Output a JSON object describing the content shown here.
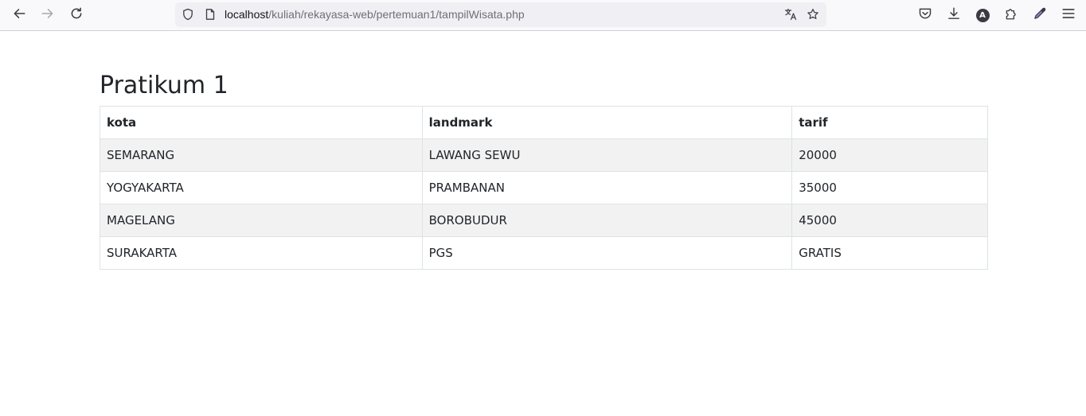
{
  "browser": {
    "url_host": "localhost",
    "url_path": "/kuliah/rekayasa-web/pertemuan1/tampilWisata.php",
    "icons": {
      "back": "back-arrow-icon",
      "forward": "forward-arrow-icon",
      "reload": "reload-icon",
      "tracking": "shield-icon",
      "page_info": "page-icon",
      "translate": "translate-icon",
      "bookmark": "star-icon",
      "pocket": "pocket-icon",
      "downloads": "download-icon",
      "account": "account-icon",
      "extensions": "extensions-icon",
      "eyedropper": "eyedropper-icon",
      "menu": "hamburger-menu-icon"
    },
    "account_initial": "A"
  },
  "page": {
    "title": "Pratikum 1"
  },
  "table": {
    "headers": [
      "kota",
      "landmark",
      "tarif"
    ],
    "rows": [
      [
        "SEMARANG",
        "LAWANG SEWU",
        "20000"
      ],
      [
        "YOGYAKARTA",
        "PRAMBANAN",
        "35000"
      ],
      [
        "MAGELANG",
        "BOROBUDUR",
        "45000"
      ],
      [
        "SURAKARTA",
        "PGS",
        "GRATIS"
      ]
    ]
  },
  "colors": {
    "stripe": "#f2f2f2",
    "border": "#dee2e6",
    "text": "#212529"
  }
}
